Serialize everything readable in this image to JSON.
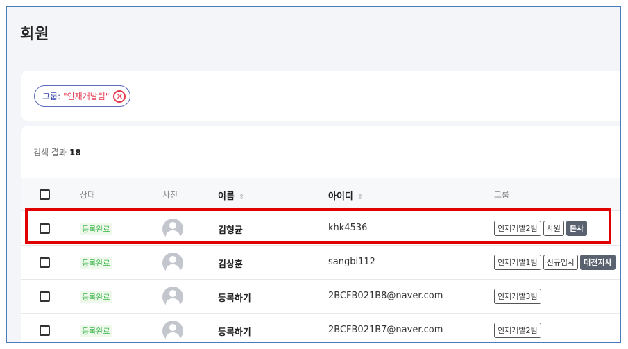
{
  "page": {
    "title": "회원"
  },
  "filter": {
    "label": "그룹: ",
    "value": "\"인재개발팀\"",
    "close_icon": "close-circle-icon"
  },
  "results": {
    "label": "검색 결과",
    "count": "18"
  },
  "table": {
    "headers": {
      "status": "상태",
      "photo": "사진",
      "name": "이름",
      "id": "아이디",
      "group": "그룹"
    },
    "sort_icon": "sort-icon",
    "rows": [
      {
        "status": "등록완료",
        "name": "김형균",
        "id": "khk4536",
        "groups": [
          "인재개발2팀",
          "사원"
        ],
        "branch": "본사"
      },
      {
        "status": "등록완료",
        "name": "김상훈",
        "id": "sangbi112",
        "groups": [
          "인재개발1팀",
          "신규입사"
        ],
        "branch": "대전지사"
      },
      {
        "status": "등록완료",
        "name": "등록하기",
        "id": "2BCFB021B8@naver.com",
        "groups": [
          "인재개발3팀"
        ],
        "branch": ""
      },
      {
        "status": "등록완료",
        "name": "등록하기",
        "id": "2BCFB021B7@naver.com",
        "groups": [
          "인재개발2팀"
        ],
        "branch": ""
      }
    ]
  },
  "colors": {
    "highlight": "#e00000",
    "status_green": "#39b54a",
    "chip_red": "#e53950",
    "chip_blue": "#5c6bc0"
  }
}
